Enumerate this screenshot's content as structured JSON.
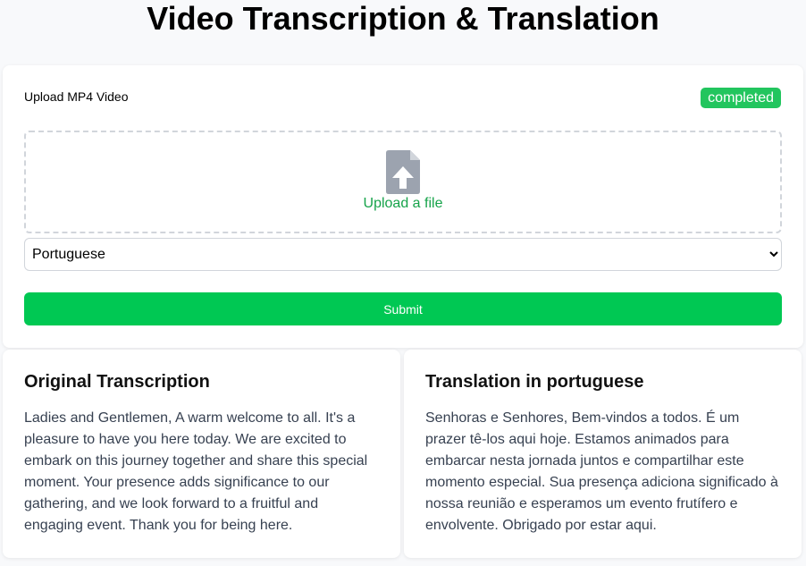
{
  "header": {
    "title": "Video Transcription & Translation"
  },
  "upload": {
    "label": "Upload MP4 Video",
    "status": "completed",
    "upload_link": "Upload a file",
    "icon": "file-upload-icon",
    "language_selected": "Portuguese",
    "language_options": [
      "Portuguese"
    ],
    "submit_label": "Submit"
  },
  "original": {
    "title": "Original Transcription",
    "text": "Ladies and Gentlemen, A warm welcome to all. It's a pleasure to have you here today. We are excited to embark on this journey together and share this special moment. Your presence adds significance to our gathering, and we look forward to a fruitful and engaging event. Thank you for being here."
  },
  "translation": {
    "title": "Translation in portuguese",
    "text": "Senhoras e Senhores, Bem-vindos a todos. É um prazer tê-los aqui hoje. Estamos animados para embarcar nesta jornada juntos e compartilhar este momento especial. Sua presença adiciona significado à nossa reunião e esperamos um evento frutífero e envolvente. Obrigado por estar aqui."
  },
  "colors": {
    "accent_green": "#00c853",
    "badge_green": "#22c55e",
    "link_green": "#16a34a",
    "icon_gray": "#9ca3af"
  }
}
